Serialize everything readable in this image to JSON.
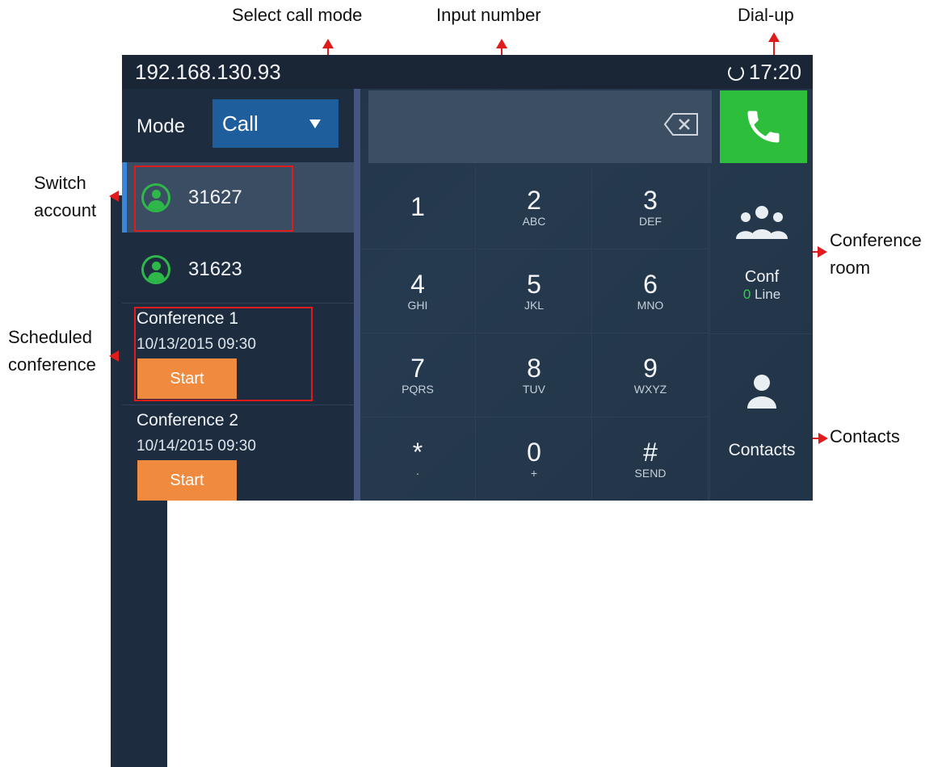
{
  "annotations": {
    "select_call_mode": "Select call mode",
    "input_number": "Input number",
    "dial_up": "Dial-up",
    "switch_account": [
      "Switch",
      "account"
    ],
    "conference_room": [
      "Conference",
      "room"
    ],
    "scheduled_conference": [
      "Scheduled",
      "conference"
    ],
    "contacts": "Contacts"
  },
  "status_bar": {
    "ip": "192.168.130.93",
    "time": "17:20"
  },
  "mode": {
    "label": "Mode",
    "value": "Call"
  },
  "accounts": [
    {
      "number": "31627",
      "active": true
    },
    {
      "number": "31623",
      "active": false
    }
  ],
  "conferences": [
    {
      "title": "Conference 1",
      "time": "10/13/2015 09:30",
      "button": "Start"
    },
    {
      "title": "Conference 2",
      "time": "10/14/2015 09:30",
      "button": "Start"
    }
  ],
  "keypad": [
    {
      "main": "1",
      "sub": ""
    },
    {
      "main": "2",
      "sub": "ABC"
    },
    {
      "main": "3",
      "sub": "DEF"
    },
    {
      "main": "4",
      "sub": "GHI"
    },
    {
      "main": "5",
      "sub": "JKL"
    },
    {
      "main": "6",
      "sub": "MNO"
    },
    {
      "main": "7",
      "sub": "PQRS"
    },
    {
      "main": "8",
      "sub": "TUV"
    },
    {
      "main": "9",
      "sub": "WXYZ"
    },
    {
      "main": "*",
      "sub": "·"
    },
    {
      "main": "0",
      "sub": "+"
    },
    {
      "main": "#",
      "sub": "SEND"
    }
  ],
  "conf_room": {
    "label": "Conf",
    "line_count": "0",
    "line_label": "Line"
  },
  "contacts_label": "Contacts",
  "colors": {
    "dial_green": "#2dbe3b",
    "start_orange": "#f08a3e",
    "mode_blue": "#1f5e9c",
    "annotation_red": "#e01b1b"
  }
}
